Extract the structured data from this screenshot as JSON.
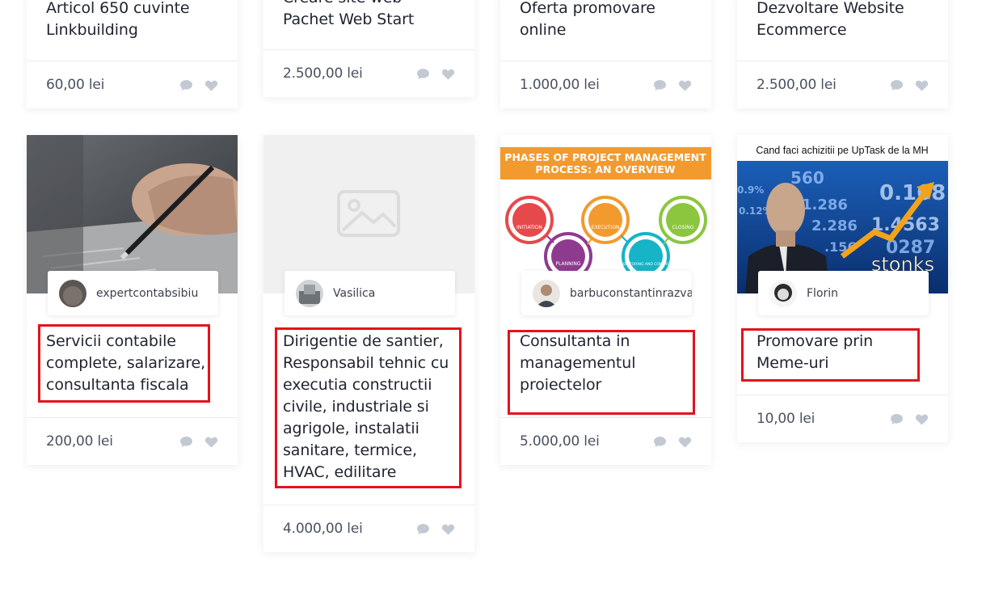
{
  "top_row": [
    {
      "title_lines": [
        "Articol 650 cuvinte",
        "Linkbuilding"
      ],
      "price": "60,00 lei"
    },
    {
      "title_lines": [
        "Creare site web",
        "Pachet Web Start"
      ],
      "price": "2.500,00 lei"
    },
    {
      "title_lines": [
        "Oferta promovare",
        "online"
      ],
      "price": "1.000,00 lei"
    },
    {
      "title_lines": [
        "Dezvoltare Website",
        "Ecommerce"
      ],
      "price": "2.500,00 lei"
    }
  ],
  "cards": [
    {
      "author": "expertcontabsibiu",
      "title_lines": [
        "Servicii contabile",
        "complete, salarizare,",
        "consultanta fiscala"
      ],
      "price": "200,00 lei",
      "thumb_icon": "photo-hand-pen"
    },
    {
      "author": "Vasilica",
      "title_lines": [
        "Dirigentie de santier,",
        "Responsabil tehnic cu",
        "executia constructii",
        "civile, industriale si",
        "agrigole, instalatii",
        "sanitare, termice,",
        "HVAC, edilitare"
      ],
      "price": "4.000,00 lei",
      "thumb_icon": "image-placeholder-icon"
    },
    {
      "author": "barbuconstantinrazvan",
      "title_lines": [
        "Consultanta in",
        "managementul",
        "proiectelor"
      ],
      "price": "5.000,00 lei",
      "thumb": {
        "heading_1": "PHASES OF PROJECT MANAGEMENT",
        "heading_2": "PROCESS: AN OVERVIEW",
        "phases": [
          "INITIATION",
          "EXECUTION",
          "CLOSING",
          "PLANNING",
          "MONITORING AND CONTROL"
        ]
      }
    },
    {
      "author": "Florin",
      "title_lines": [
        "Promovare prin",
        "Meme-uri"
      ],
      "price": "10,00 lei",
      "thumb": {
        "caption": "Cand faci achizitii pe UpTask de la MH",
        "meme_text": "stonks",
        "ticker": [
          "560",
          "1.286",
          "2.286",
          "0.168",
          "1.4563",
          "0.9%",
          "0.12%",
          ".156",
          "0287"
        ]
      }
    }
  ],
  "icons": {
    "comment": "comment-icon",
    "heart": "heart-icon"
  },
  "colors": {
    "icon_gray": "#c3c9d3",
    "highlight": "#e3131c",
    "accent_orange": "#f29a2e"
  }
}
